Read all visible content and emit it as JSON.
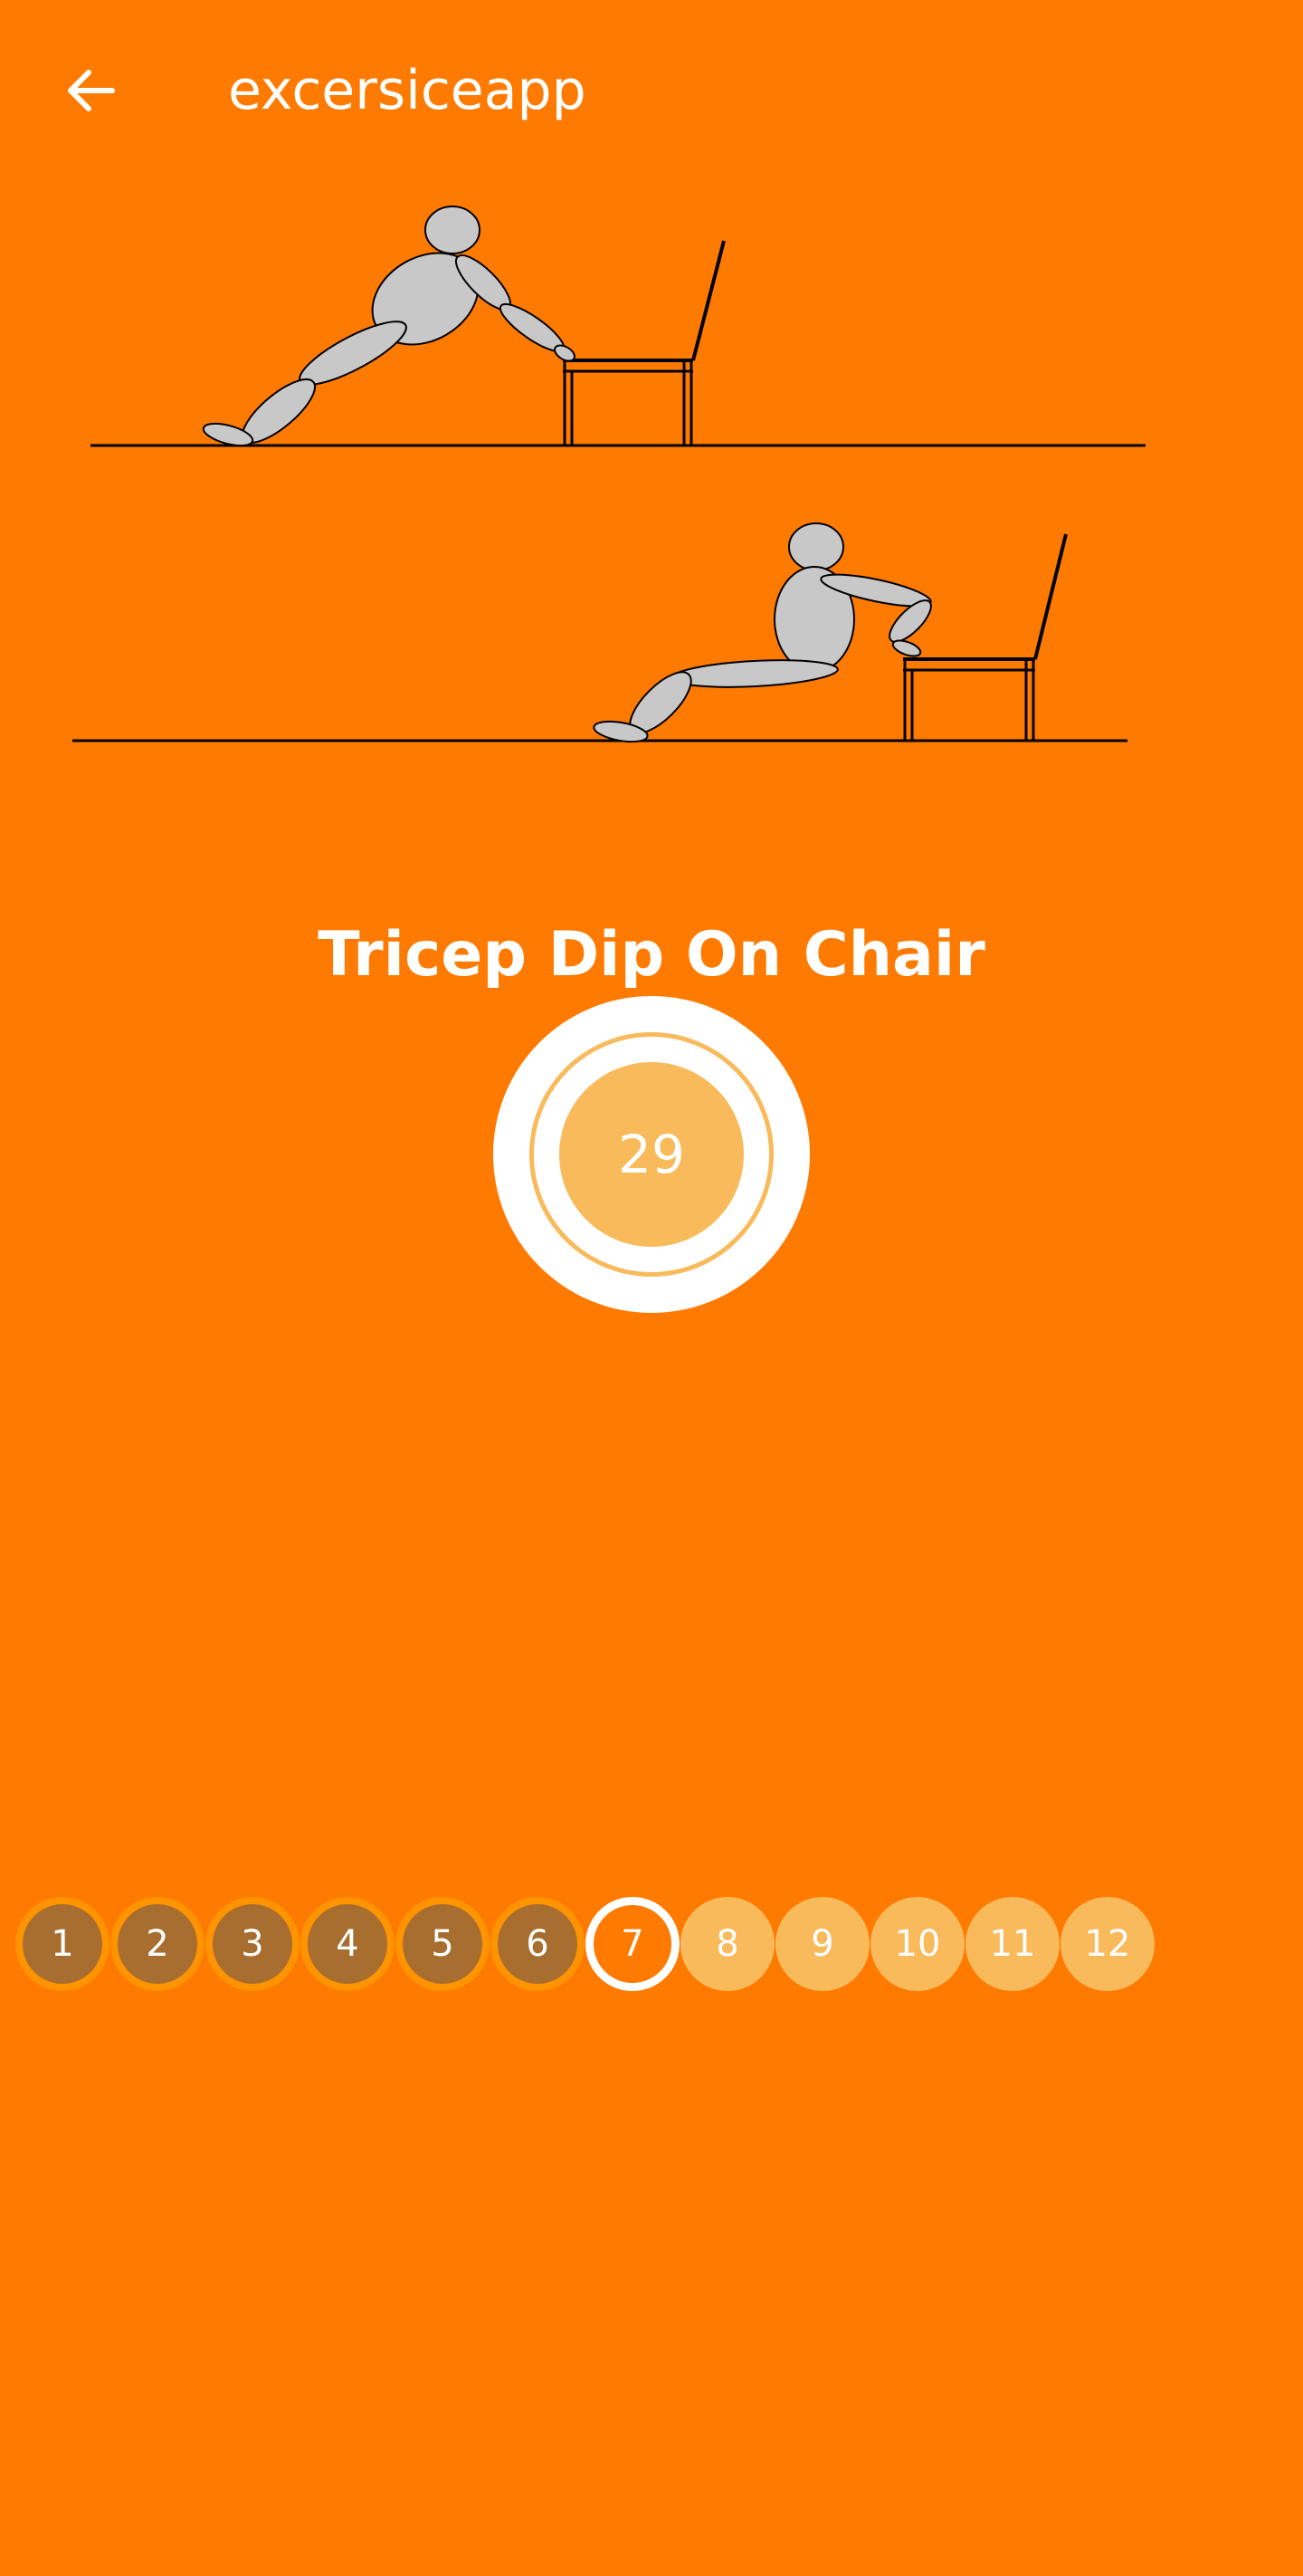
{
  "app_bar": {
    "title": "excersiceapp",
    "back_icon": "arrow-left-icon"
  },
  "exercise": {
    "name": "Tricep Dip On Chair",
    "timer_value": "29"
  },
  "steps": [
    {
      "label": "1",
      "state": "done"
    },
    {
      "label": "2",
      "state": "done"
    },
    {
      "label": "3",
      "state": "done"
    },
    {
      "label": "4",
      "state": "done"
    },
    {
      "label": "5",
      "state": "done"
    },
    {
      "label": "6",
      "state": "done"
    },
    {
      "label": "7",
      "state": "current"
    },
    {
      "label": "8",
      "state": "pending"
    },
    {
      "label": "9",
      "state": "pending"
    },
    {
      "label": "10",
      "state": "pending"
    },
    {
      "label": "11",
      "state": "pending"
    },
    {
      "label": "12",
      "state": "pending"
    }
  ],
  "colors": {
    "background": "#FF7A00",
    "done_step": "#A76E30",
    "pending_step": "#F9BA5B",
    "figure": "#C8C8C8"
  }
}
